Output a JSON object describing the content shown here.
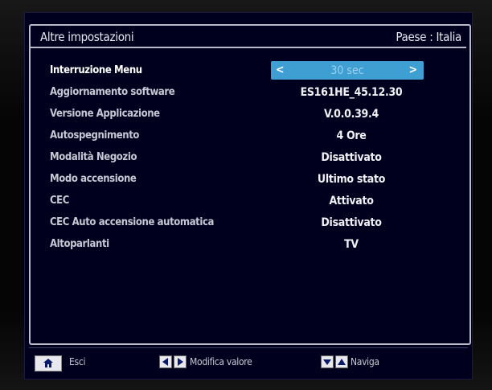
{
  "header": {
    "title": "Altre impostazioni",
    "country": "Paese : Italia"
  },
  "menu": {
    "selected_value": "30 sec",
    "rows": [
      {
        "label": "Interruzione Menu",
        "value": ""
      },
      {
        "label": "Aggiornamento software",
        "value": "ES161HE_45.12.30"
      },
      {
        "label": "Versione Applicazione",
        "value": "V.0.0.39.4"
      },
      {
        "label": "Autospegnimento",
        "value": "4 Ore"
      },
      {
        "label": "Modalità Negozio",
        "value": "Disattivato"
      },
      {
        "label": "Modo accensione",
        "value": "Ultimo stato"
      },
      {
        "label": "CEC",
        "value": "Attivato"
      },
      {
        "label": "CEC  Auto accensione automatica",
        "value": "Disattivato"
      },
      {
        "label": "Altoparlanti",
        "value": "TV"
      }
    ]
  },
  "footer": {
    "exit_label": "Esci",
    "edit_label": "Modifica valore",
    "nav_label": "Naviga"
  },
  "colors": {
    "background": "#00001e",
    "accent": "#3f9fd2",
    "border": "#b9bcc9"
  }
}
